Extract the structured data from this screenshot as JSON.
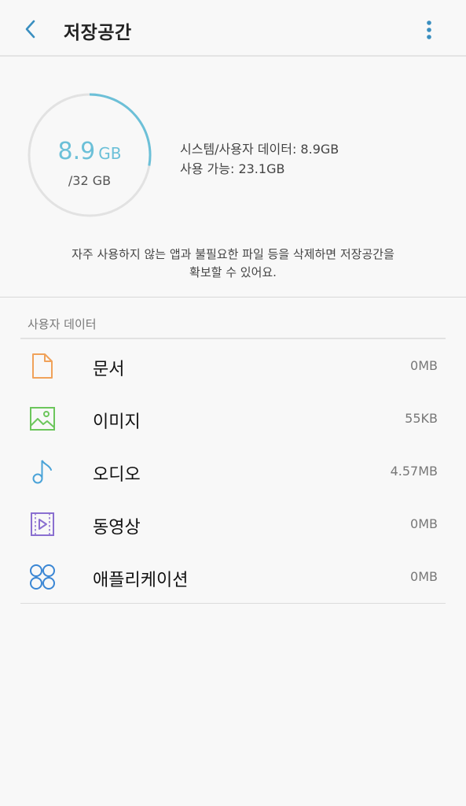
{
  "appbar": {
    "title": "저장공간",
    "back_icon": "chevron-left-icon",
    "more_icon": "more-vert-icon"
  },
  "storage": {
    "used_value": "8.9",
    "used_unit": "GB",
    "total": "/32 GB",
    "used_fraction": 0.278,
    "system_user_data": "시스템/사용자 데이터: 8.9GB",
    "available": "사용 가능: 23.1GB",
    "tip_line1": "자주 사용하지 않는 앱과 불필요한 파일 등을 삭제하면 저장공간을",
    "tip_line2": "확보할 수 있어요.",
    "ring_color": "#6cc0d8",
    "ring_track_color": "#e2e2e2"
  },
  "user_data": {
    "header": "사용자 데이터",
    "items": [
      {
        "label": "문서",
        "size": "0MB",
        "icon": "document-icon",
        "color": "#f0a25a"
      },
      {
        "label": "이미지",
        "size": "55KB",
        "icon": "image-icon",
        "color": "#6cc65c"
      },
      {
        "label": "오디오",
        "size": "4.57MB",
        "icon": "music-note-icon",
        "color": "#4aa3d8"
      },
      {
        "label": "동영상",
        "size": "0MB",
        "icon": "video-icon",
        "color": "#8a6fd0"
      },
      {
        "label": "애플리케이션",
        "size": "0MB",
        "icon": "apps-icon",
        "color": "#3a86d4"
      }
    ]
  }
}
